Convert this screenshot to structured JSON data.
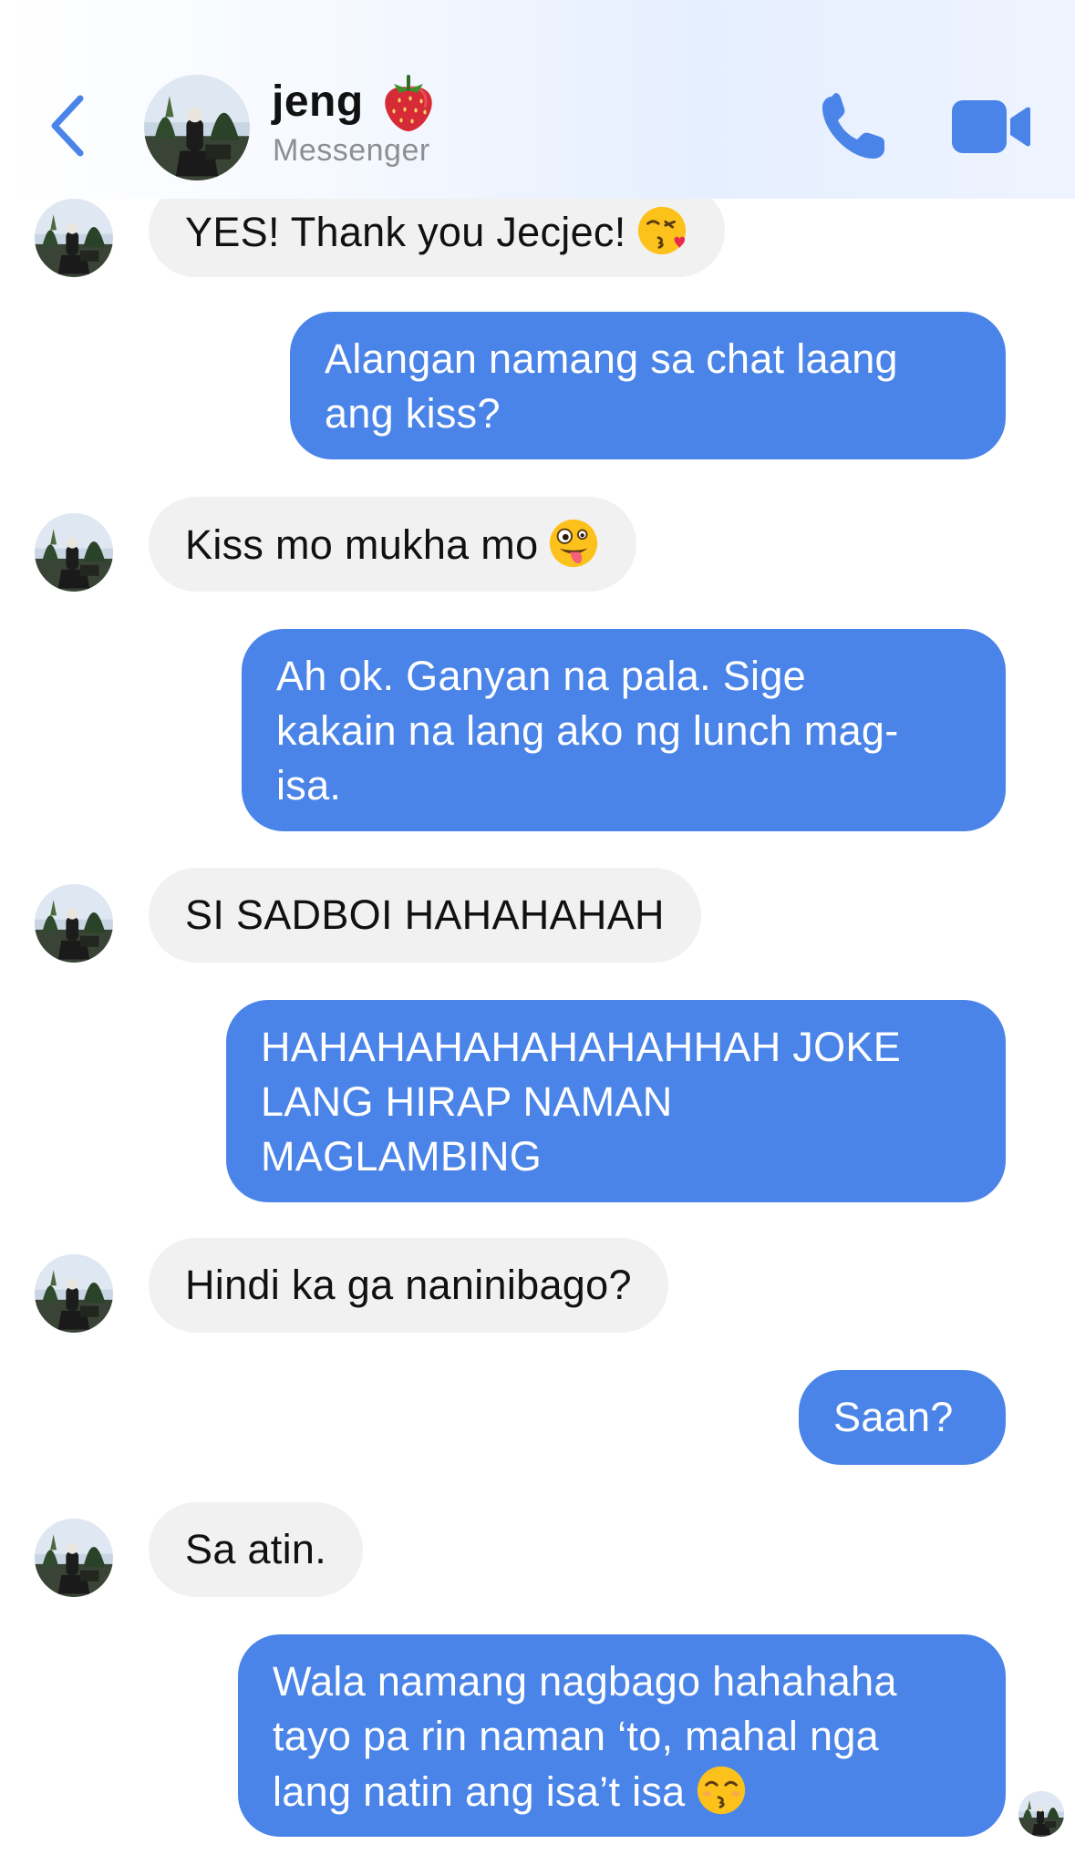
{
  "header": {
    "contact_name": "jeng",
    "name_emoji": "strawberry",
    "subtitle": "Messenger",
    "icons": {
      "back": "chevron-left-icon",
      "call": "phone-icon",
      "video": "video-camera-icon"
    }
  },
  "colors": {
    "accent": "#4a84e8",
    "incoming_bubble": "#f1f1f2",
    "incoming_text": "#111111",
    "outgoing_text": "#ffffff",
    "subtitle": "#8e8e93"
  },
  "messages": [
    {
      "sender": "contact",
      "text": "YES! Thank you Jecjec!",
      "emoji": "kissing-heart-emoji"
    },
    {
      "sender": "me",
      "lines": [
        "Alangan namang sa chat laang",
        "ang kiss?"
      ]
    },
    {
      "sender": "contact",
      "text": "Kiss mo mukha mo",
      "emoji": "zany-face-emoji"
    },
    {
      "sender": "me",
      "lines": [
        "Ah ok. Ganyan na pala. Sige",
        "kakain na lang ako ng lunch mag-",
        "isa."
      ]
    },
    {
      "sender": "contact",
      "text": "SI SADBOI HAHAHAHAH"
    },
    {
      "sender": "me",
      "lines": [
        "HAHAHAHAHAHAHAHHAH JOKE",
        "LANG HIRAP NAMAN",
        "MAGLAMBING"
      ]
    },
    {
      "sender": "contact",
      "text": "Hindi ka ga naninibago?"
    },
    {
      "sender": "me",
      "lines": [
        "Saan?"
      ]
    },
    {
      "sender": "contact",
      "text": "Sa atin."
    },
    {
      "sender": "me",
      "lines": [
        "Wala namang nagbago hahahaha",
        "tayo pa rin naman ‘to, mahal nga",
        "lang natin ang isa’t isa"
      ],
      "emoji": "kissing-smiling-eyes-emoji"
    }
  ]
}
